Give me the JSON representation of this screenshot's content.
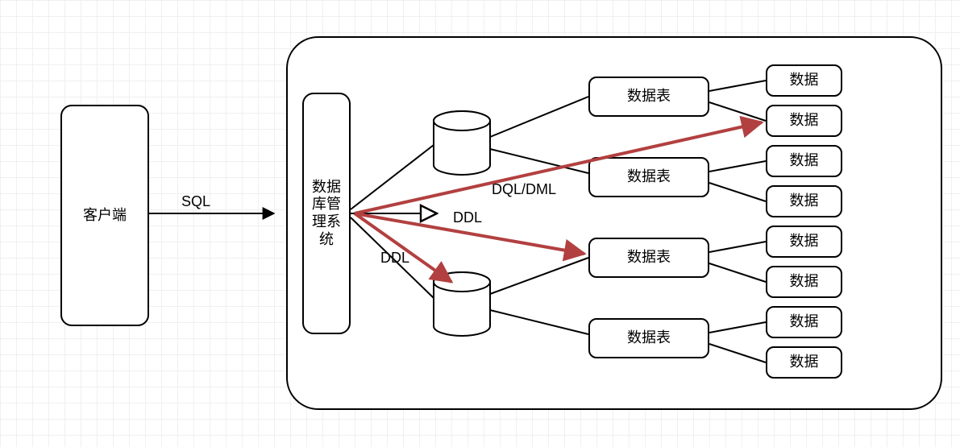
{
  "nodes": {
    "client": "客户端",
    "dbms": "数据\n库管\n理系\n统",
    "db1": "数据库",
    "db2": "数据库",
    "table1": "数据表",
    "table2": "数据表",
    "table3": "数据表",
    "table4": "数据表",
    "data1": "数据",
    "data2": "数据",
    "data3": "数据",
    "data4": "数据",
    "data5": "数据",
    "data6": "数据",
    "data7": "数据",
    "data8": "数据"
  },
  "labels": {
    "sql": "SQL",
    "ddl1": "DDL",
    "ddl2": "DDL",
    "dqldml": "DQL/DML"
  }
}
